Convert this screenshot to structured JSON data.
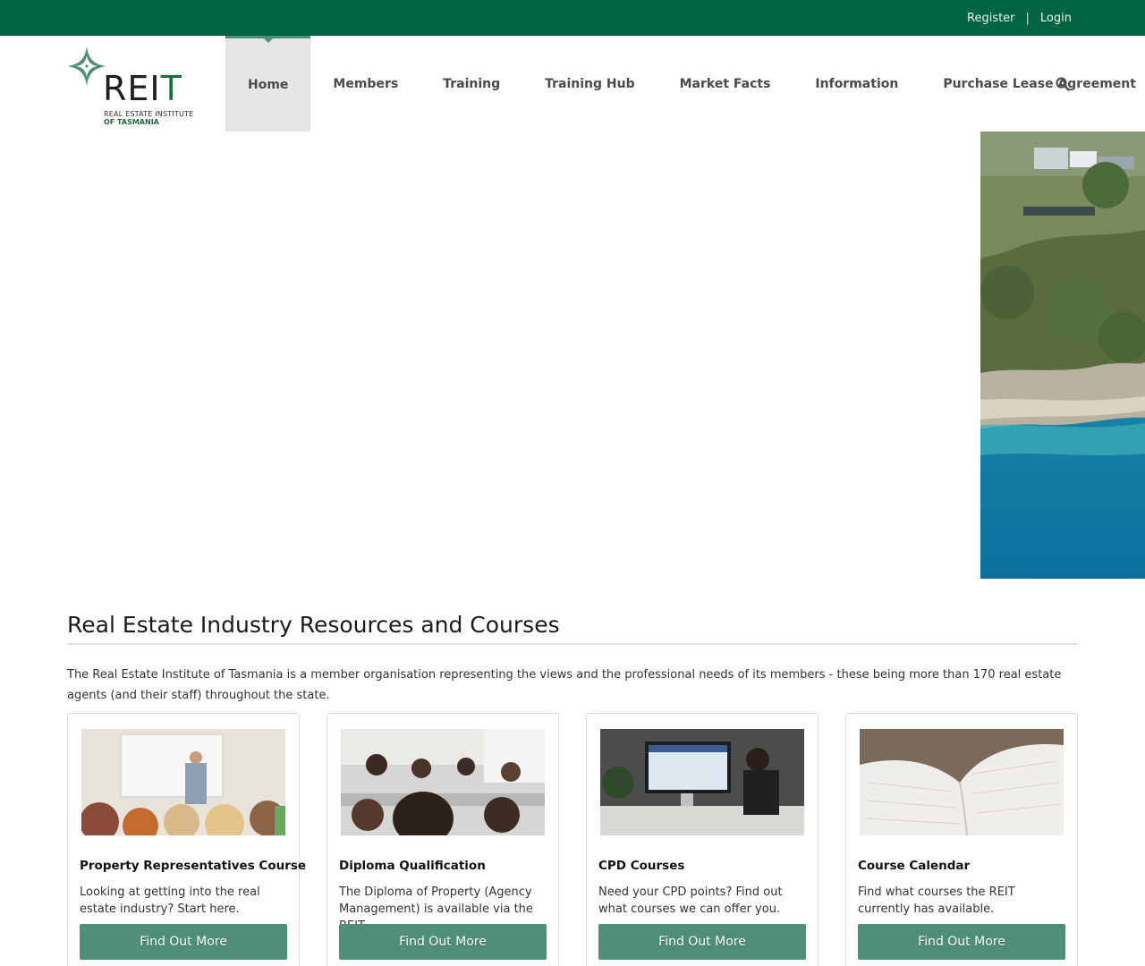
{
  "topbar": {
    "register_label": "Register",
    "separator": "|",
    "login_label": "Login"
  },
  "logo": {
    "wordmark_main": "REI",
    "wordmark_accent": "T",
    "subtitle_line1": "REAL ESTATE INSTITUTE",
    "subtitle_line2": "OF TASMANIA"
  },
  "nav": {
    "items": [
      {
        "label": "Home",
        "active": true
      },
      {
        "label": "Members"
      },
      {
        "label": "Training"
      },
      {
        "label": "Training Hub"
      },
      {
        "label": "Market Facts"
      },
      {
        "label": "Information"
      },
      {
        "label": "Purchase Lease Agreement"
      }
    ],
    "search_icon": "search-icon"
  },
  "main": {
    "title": "Real Estate Industry Resources and Courses",
    "intro": "The Real Estate Institute of Tasmania is a member organisation representing the views and the professional needs of its members - these being more than 170 real estate agents (and their staff) throughout the state."
  },
  "cards": [
    {
      "title": "Property Representatives Course",
      "text": "Looking at getting into the real estate industry? Start here.",
      "button": "Find Out More"
    },
    {
      "title": "Diploma Qualification",
      "text": "The Diploma of Property (Agency Management) is available via the REIT.",
      "button": "Find Out More"
    },
    {
      "title": "CPD Courses",
      "text": "Need your CPD points? Find out what courses we can offer you.",
      "button": "Find Out More"
    },
    {
      "title": "Course Calendar",
      "text": "Find what courses the REIT currently has available.",
      "button": "Find Out More"
    }
  ],
  "colors": {
    "brand_green": "#006642",
    "accent_teal": "#4f8f7a",
    "active_nav_bg": "#e6e6e6"
  }
}
